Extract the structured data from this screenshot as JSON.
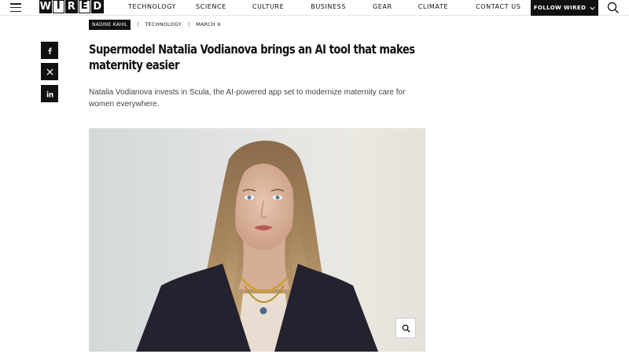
{
  "brand": {
    "logo_letters": [
      "W",
      "I",
      "R",
      "E",
      "D"
    ]
  },
  "nav": {
    "links": [
      "TECHNOLOGY",
      "SCIENCE",
      "CULTURE",
      "BUSINESS",
      "GEAR",
      "CLIMATE",
      "CONTACT US"
    ],
    "follow_label": "FOLLOW WIRED"
  },
  "article": {
    "author": "NADINE KAHIL",
    "section": "TECHNOLOGY",
    "date": "MARCH 9",
    "headline": "Supermodel Natalia Vodianova brings an AI tool that makes maternity easier",
    "dek": "Natalia Vodianova invests in Scula, the AI-powered app set to modernize maternity care for women everywhere."
  },
  "share": {
    "buttons": [
      "facebook",
      "x",
      "linkedin"
    ]
  },
  "icons": {
    "menu": "menu-icon",
    "search": "search-icon",
    "zoom": "zoom-icon",
    "chevron": "chevron-down-icon"
  },
  "colors": {
    "ink": "#111111",
    "background": "#ffffff",
    "muted_text": "#444444"
  }
}
